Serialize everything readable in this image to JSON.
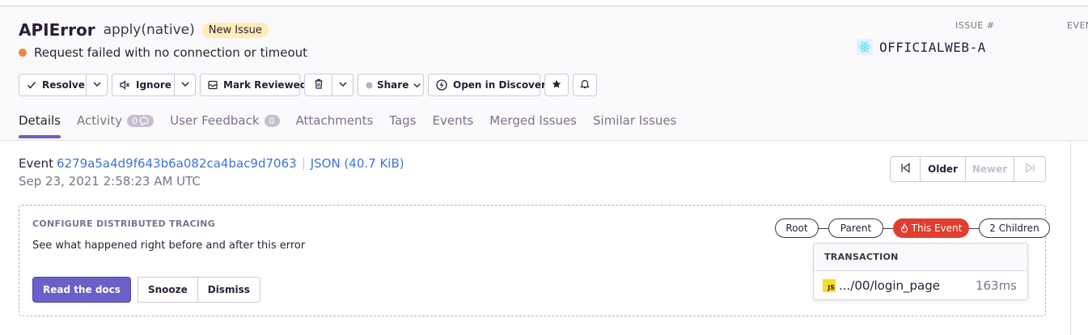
{
  "issue": {
    "title": "APIError",
    "subtitle": "apply(native)",
    "badge": "New Issue",
    "message": "Request failed with no connection or timeout",
    "issue_label": "ISSUE #",
    "issue_id": "OFFICIALWEB-A",
    "events_label": "EVEN"
  },
  "actions": {
    "resolve": "Resolve",
    "ignore": "Ignore",
    "mark_reviewed": "Mark Reviewed",
    "share": "Share",
    "open_discover": "Open in Discover"
  },
  "tabs": [
    {
      "label": "Details",
      "active": true
    },
    {
      "label": "Activity",
      "count": "0"
    },
    {
      "label": "User Feedback",
      "count": "0"
    },
    {
      "label": "Attachments"
    },
    {
      "label": "Tags"
    },
    {
      "label": "Events"
    },
    {
      "label": "Merged Issues"
    },
    {
      "label": "Similar Issues"
    }
  ],
  "event": {
    "label": "Event",
    "id": "6279a5a4d9f643b6a082ca4bac9d7063",
    "json": "JSON (40.7 KiB)",
    "date": "Sep 23, 2021 2:58:23 AM UTC"
  },
  "nav": {
    "older": "Older",
    "newer": "Newer"
  },
  "tracing": {
    "heading": "CONFIGURE DISTRIBUTED TRACING",
    "description": "See what happened right before and after this error",
    "read_docs": "Read the docs",
    "snooze": "Snooze",
    "dismiss": "Dismiss",
    "crumbs": [
      "Root",
      "Parent",
      "This Event",
      "2 Children"
    ],
    "popup_heading": "TRANSACTION",
    "transaction_name": ".../00/login_page",
    "transaction_duration": "163ms",
    "js_icon": "JS"
  },
  "colors": {
    "accent": "#6c5fc7",
    "link": "#3d74db",
    "error": "#e03e2f",
    "warning_dot": "#f5843b",
    "badge_bg": "#ffedb8"
  }
}
